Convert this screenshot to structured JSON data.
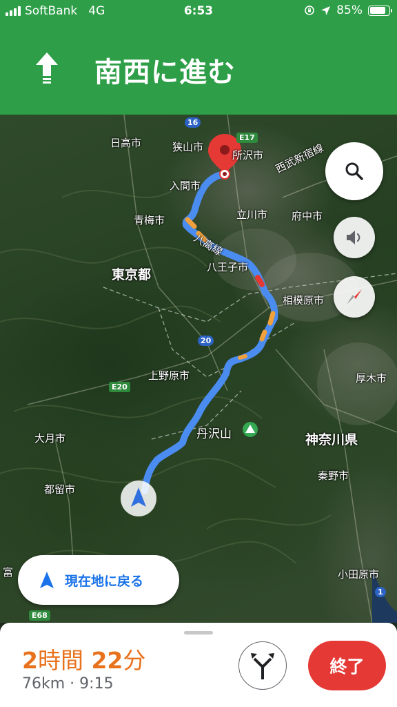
{
  "status_bar": {
    "carrier": "SoftBank",
    "network": "4G",
    "time": "6:53",
    "battery_percent": "85%",
    "battery_level": 0.85,
    "icons": [
      "signal-icon",
      "screen-lock-rotation-icon",
      "location-arrow-icon",
      "battery-icon"
    ]
  },
  "navigation": {
    "instruction": "南西に進む",
    "direction_icon": "arrow-up-icon"
  },
  "map": {
    "labels": {
      "hidaka": "日高市",
      "sayama": "狭山市",
      "tokorozawa": "所沢市",
      "iruma": "入間市",
      "seibu_line": "西武新宿線",
      "ome": "青梅市",
      "tachikawa": "立川市",
      "fuchu": "府中市",
      "hachiko_line": "八高線",
      "tokyo": "東京都",
      "hachioji": "八王子市",
      "sagamihara": "相模原市",
      "uenohara": "上野原市",
      "atsugi": "厚木市",
      "otsuki": "大月市",
      "tanzawa": "丹沢山",
      "kanagawa": "神奈川県",
      "hadano": "秦野市",
      "tsuru": "都留市",
      "odawara": "小田原市",
      "fuji_partial": "富"
    },
    "shields": {
      "r16": "16",
      "e17": "E17",
      "r20": "20",
      "e20": "E20",
      "e68": "E68",
      "r1": "1"
    },
    "accent_route": "#4a8cf0",
    "accent_pin": "#e53935"
  },
  "controls": {
    "search_icon": "search-icon",
    "sound_icon": "speaker-icon",
    "compass_icon": "compass-icon",
    "recenter_label": "現在地に戻る"
  },
  "trip": {
    "eta_hours": "2",
    "eta_hours_unit": "時間",
    "eta_minutes": "22",
    "eta_minutes_unit": "分",
    "distance": "76km",
    "separator": "·",
    "arrival_time": "9:15",
    "alt_routes_icon": "alternate-routes-icon",
    "end_label": "終了",
    "eta_color": "#e8711c",
    "end_color": "#e53935"
  }
}
